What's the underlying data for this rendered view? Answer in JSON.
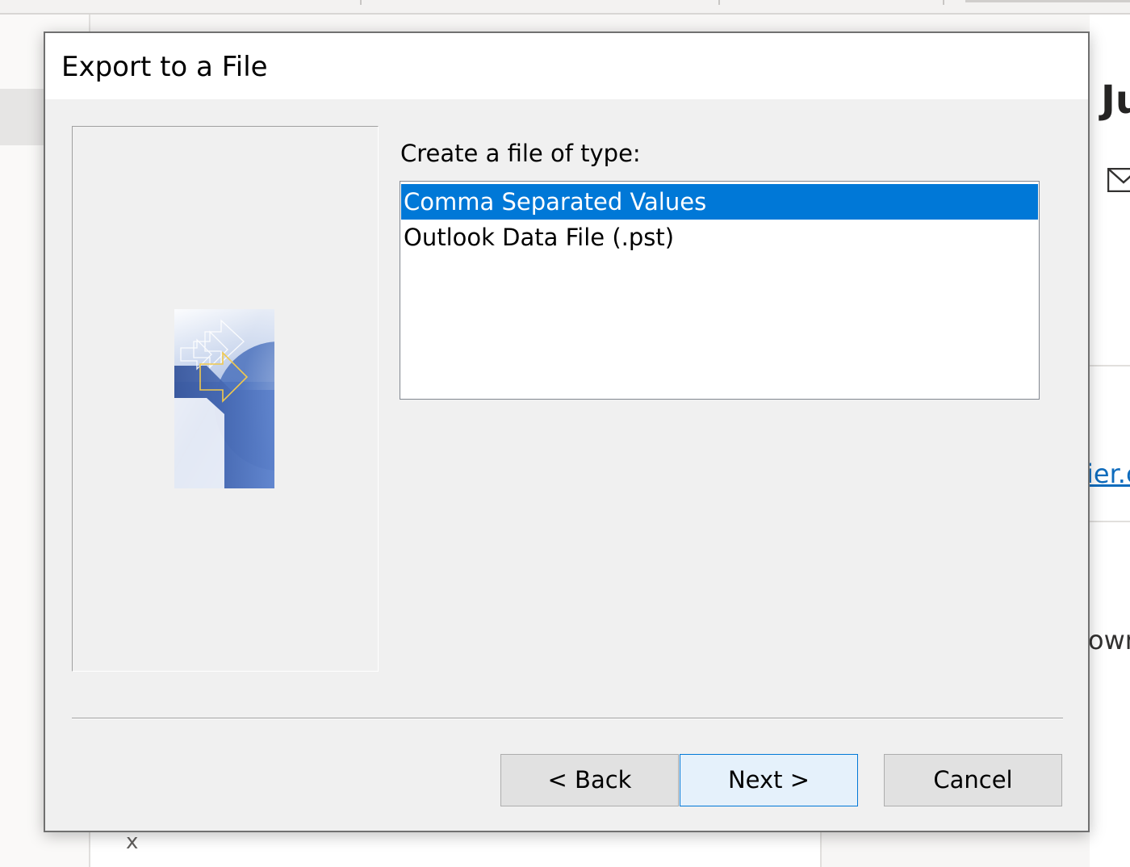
{
  "background": {
    "close_label": "x",
    "right_title_fragment": "Ju",
    "right_link_fragment": "ier.c",
    "right_text_fragment": "owr",
    "icons": {
      "mail": "mail-icon"
    }
  },
  "dialog": {
    "title": "Export to a File",
    "prompt": "Create a file of type:",
    "file_types": [
      {
        "label": "Comma Separated Values",
        "selected": true
      },
      {
        "label": "Outlook Data File (.pst)",
        "selected": false
      }
    ],
    "buttons": {
      "back": "< Back",
      "next": "Next >",
      "cancel": "Cancel"
    },
    "colors": {
      "selection": "#0078d7",
      "default_button": "#e5f1fb",
      "dialog_bg": "#f0f0f0"
    }
  }
}
